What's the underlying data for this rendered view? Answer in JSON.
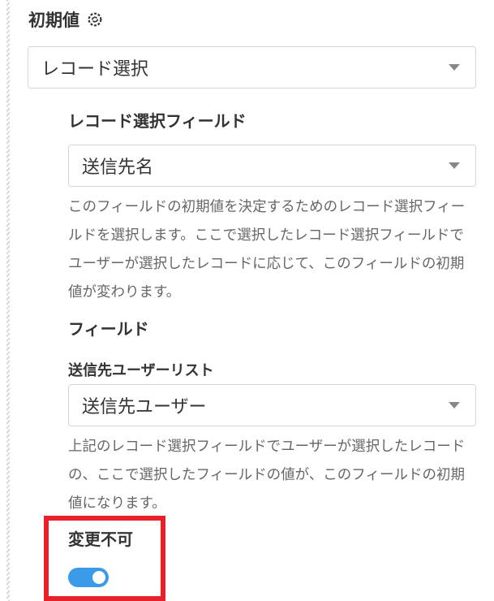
{
  "initial_value": {
    "title": "初期値",
    "select_value": "レコード選択"
  },
  "record_field": {
    "heading": "レコード選択フィールド",
    "select_value": "送信先名",
    "description": "このフィールドの初期値を決定するためのレコード選択フィールドを選択します。ここで選択したレコード選択フィールドでユーザーが選択したレコードに応じて、このフィールドの初期値が変わります。"
  },
  "field": {
    "heading": "フィールド",
    "list_label": "送信先ユーザーリスト",
    "select_value": "送信先ユーザー",
    "description": "上記のレコード選択フィールドでユーザーが選択したレコードの、ここで選択したフィールドの値が、このフィールドの初期値になります。"
  },
  "readonly": {
    "heading": "変更不可",
    "toggle_on": true
  },
  "colors": {
    "toggle": "#3b9be8",
    "highlight": "#e8202a"
  },
  "icons": {
    "title_icon": "gear-sync-icon",
    "dropdown_icon": "caret-down-icon"
  }
}
